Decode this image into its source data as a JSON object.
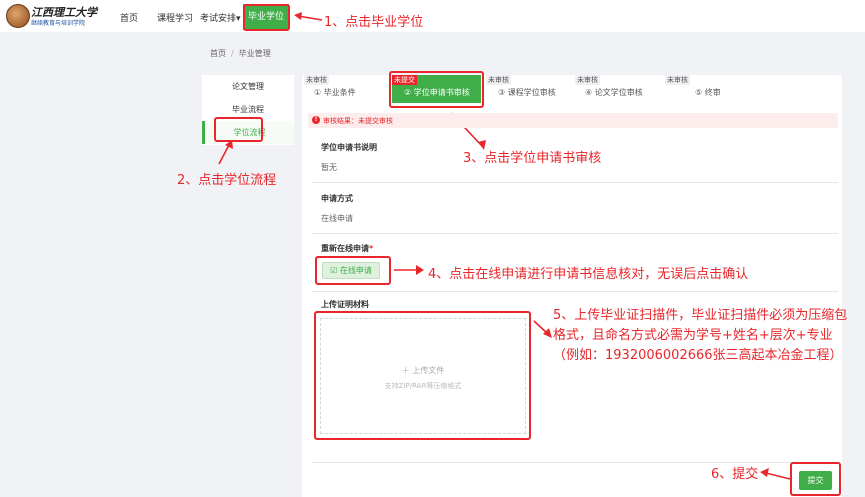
{
  "logo": {
    "title": "江西理工大学",
    "subtitle": "继续教育与培训学院"
  },
  "nav": {
    "home": "首页",
    "courses": "课程学习",
    "exams": "考试安排",
    "graduation": "毕业学位"
  },
  "breadcrumb": {
    "home": "首页",
    "current": "毕业管理"
  },
  "sidebar": {
    "items": [
      "论文管理",
      "毕业流程",
      "学位流程"
    ]
  },
  "steps": [
    {
      "tag": "未审核",
      "label": "① 毕业条件"
    },
    {
      "tag": "未提交",
      "label": "② 学位申请书审核"
    },
    {
      "tag": "未审核",
      "label": "③ 课程学位审核"
    },
    {
      "tag": "未审核",
      "label": "④ 论文学位审核"
    },
    {
      "tag": "未审核",
      "label": "⑤ 终审"
    }
  ],
  "alert": {
    "text": "审核结果：未提交审核"
  },
  "sections": {
    "explain_title": "学位申请书说明",
    "explain_value": "暂无",
    "method_title": "申请方式",
    "method_value": "在线申请",
    "reapply_title": "重新在线申请",
    "reapply_required": "*",
    "apply_button": "在线申请",
    "upload_title": "上传证明材料",
    "upload_label": "上传文件",
    "upload_hint": "支持ZIP/RAR等压缩格式"
  },
  "submit_label": "提交",
  "annotations": {
    "a1": "1、点击毕业学位",
    "a2": "2、点击学位流程",
    "a3": "3、点击学位申请书审核",
    "a4": "4、点击在线申请进行申请书信息核对，无误后点击确认",
    "a5_line1": "5、上传毕业证扫描件，毕业证扫描件必须为压缩包",
    "a5_line2": "格式，且命名方式必需为学号+姓名+层次+专业",
    "a5_line3": "（例如：1932006002666张三高起本冶金工程）",
    "a6": "6、提交"
  },
  "colors": {
    "accent": "#3fae49",
    "annotation": "#e8262b"
  }
}
